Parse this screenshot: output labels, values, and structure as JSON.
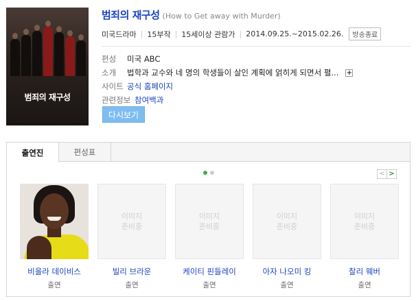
{
  "poster": {
    "title": "범죄의 재구성"
  },
  "title": {
    "main": "범죄의 재구성",
    "original": "(How to Get away with Murder)"
  },
  "meta": {
    "genre": "미국드라마",
    "episodes": "15부작",
    "rating": "15세이상 관람가",
    "period": "2014.09.25.~2015.02.26.",
    "status": "방송종료"
  },
  "details": {
    "channel": {
      "label": "편성",
      "value": "미국 ABC"
    },
    "synopsis": {
      "label": "소개",
      "value": "법학과 교수와 네 명의 학생들이 살인 계획에 얽히게 되면서 펼..."
    },
    "site": {
      "label": "사이트",
      "value": "공식 홈페이지"
    },
    "related": {
      "label": "관련정보",
      "value": "참여백과"
    }
  },
  "rewatch_button": "다시보기",
  "tabs": [
    "출연진",
    "편성표"
  ],
  "placeholder_text": "이미지\n준비중",
  "nav": {
    "prev": "<",
    "next": ">"
  },
  "cast": [
    {
      "name": "비올라 데이비스",
      "role": "출연"
    },
    {
      "name": "빌리 브라운",
      "role": "출연"
    },
    {
      "name": "케이티 핀들레이",
      "role": "출연"
    },
    {
      "name": "아자 나오미 킹",
      "role": "출연"
    },
    {
      "name": "찰리 웨버",
      "role": "출연"
    }
  ],
  "colors": {
    "link": "#1a44c1",
    "button": "#7fbdf0",
    "active_dot": "#3fae49",
    "badge_border": "#bbbbbb"
  }
}
